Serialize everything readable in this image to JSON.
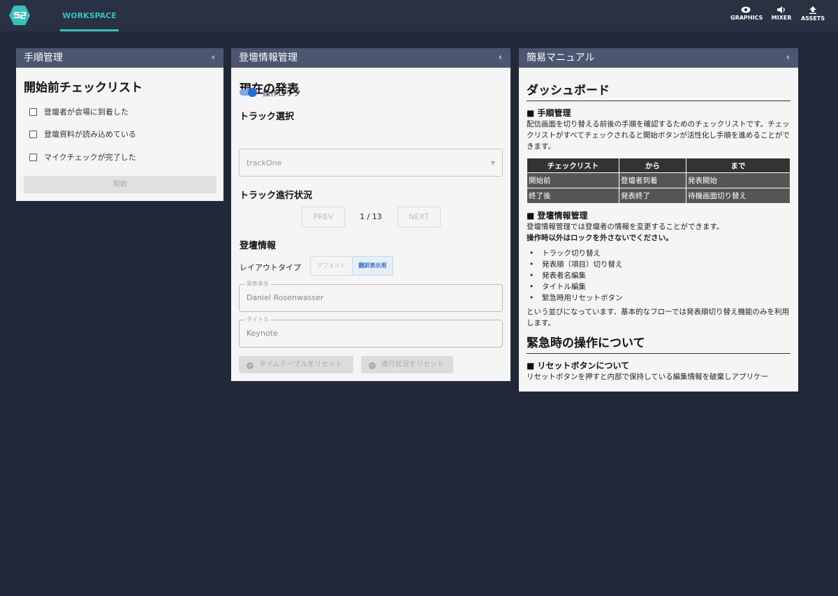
{
  "topbar": {
    "workspace_tab": "WORKSPACE",
    "buttons": [
      {
        "label": "GRAPHICS",
        "icon": "eye-icon"
      },
      {
        "label": "MIXER",
        "icon": "speaker-icon"
      },
      {
        "label": "ASSETS",
        "icon": "upload-icon"
      }
    ],
    "accent_color": "#36c2bd"
  },
  "panel_procedure": {
    "title": "手順管理",
    "heading": "開始前チェックリスト",
    "checklist": [
      "登壇者が会場に到着した",
      "登壇資料が読み込めている",
      "マイクチェックが完了した"
    ],
    "start_label": "開始"
  },
  "panel_speaker": {
    "title": "登壇情報管理",
    "heading": "現在の発表",
    "lock_label": "操作ロック",
    "lock_on": true,
    "track_heading": "トラック選択",
    "track_value": "trackOne",
    "progress_heading": "トラック進行状況",
    "prev_label": "PREV",
    "page_indicator": "1 / 13",
    "next_label": "NEXT",
    "info_heading": "登壇情報",
    "layout_label": "レイアウトタイプ",
    "layout_options": [
      "デフォルト",
      "翻訳表示用"
    ],
    "layout_selected": "翻訳表示用",
    "presenter_label": "発表者名",
    "presenter_value": "Daniel Rosenwasser",
    "title_label": "タイトル",
    "title_value": "Keynote",
    "reset_timetable_label": "タイムテーブルをリセット",
    "reset_progress_label": "進行状況をリセット"
  },
  "panel_manual": {
    "title": "簡易マニュアル",
    "dashboard_heading": "ダッシュボード",
    "section1_heading": "■ 手順管理",
    "section1_text": "配信画面を切り替える前後の手順を確認するためのチェックリストです。チェックリストがすべてチェックされると開始ボタンが活性化し手順を進めることができます。",
    "table": {
      "headers": [
        "チェックリスト",
        "から",
        "まで"
      ],
      "rows": [
        [
          "開始前",
          "登壇者到着",
          "発表開始"
        ],
        [
          "終了後",
          "発表終了",
          "待機画面切り替え"
        ]
      ]
    },
    "section2_heading": "■ 登壇情報管理",
    "section2_text": "登壇情報管理では登壇者の情報を変更することができます。",
    "section2_bold": "操作時以外はロックを外さないでください。",
    "list_items": [
      "トラック切り替え",
      "発表順（項目）切り替え",
      "発表者名編集",
      "タイトル編集",
      "緊急時用リセットボタン"
    ],
    "section2_after": "という並びになっています、基本的なフローでは発表順切り替え機能のみを利用します。",
    "emergency_heading": "緊急時の操作について",
    "section3_heading": "■ リセットボタンについて",
    "section3_text": "リセットボタンを押すと内部で保持している編集情報を破棄しアプリケー"
  }
}
